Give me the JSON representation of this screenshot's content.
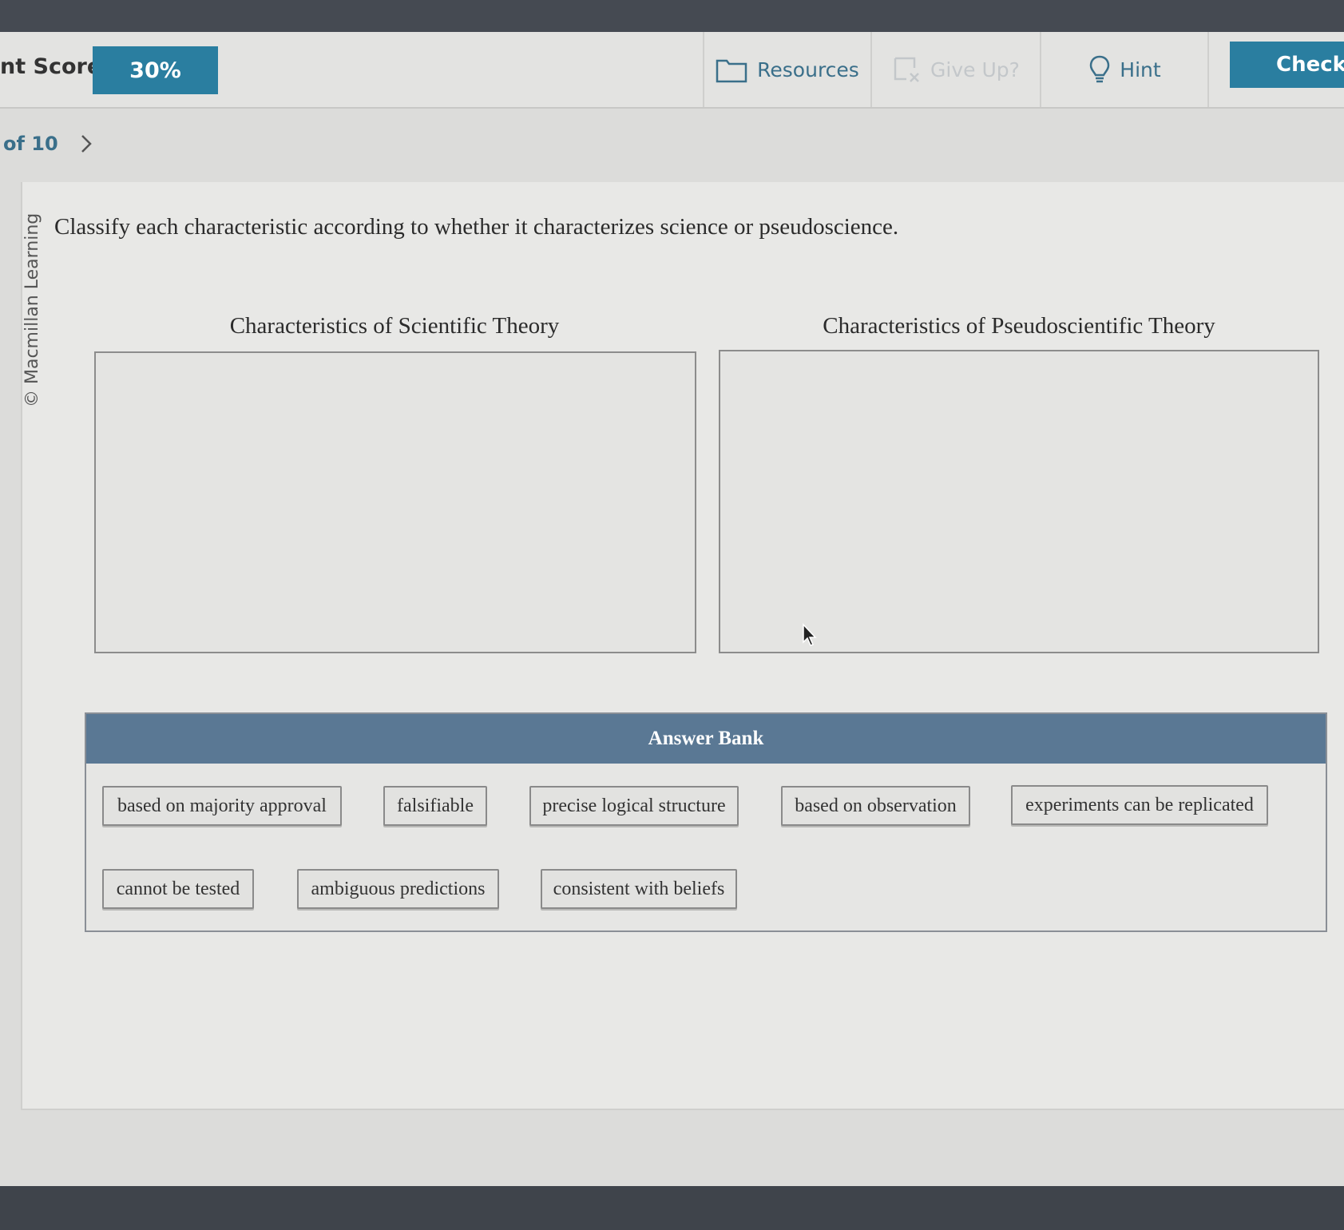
{
  "header": {
    "score_label": "nt Score:",
    "score_value": "30%",
    "resources_label": "Resources",
    "give_up_label": "Give Up?",
    "hint_label": "Hint",
    "check_label": "Check A"
  },
  "nav": {
    "counter": "of 10"
  },
  "content": {
    "copyright": "© Macmillan Learning",
    "question": "Classify each characteristic according to whether it characterizes science or pseudoscience.",
    "bins": [
      {
        "title": "Characteristics of Scientific Theory"
      },
      {
        "title": "Characteristics of Pseudoscientific Theory"
      }
    ]
  },
  "answer_bank": {
    "title": "Answer Bank",
    "items": [
      "based on majority approval",
      "falsifiable",
      "precise logical structure",
      "based on observation",
      "experiments can be replicated",
      "cannot be tested",
      "ambiguous predictions",
      "consistent with beliefs"
    ]
  },
  "colors": {
    "accent": "#2a7ea0",
    "bank_header": "#5a7894",
    "link": "#3a6f8a"
  }
}
